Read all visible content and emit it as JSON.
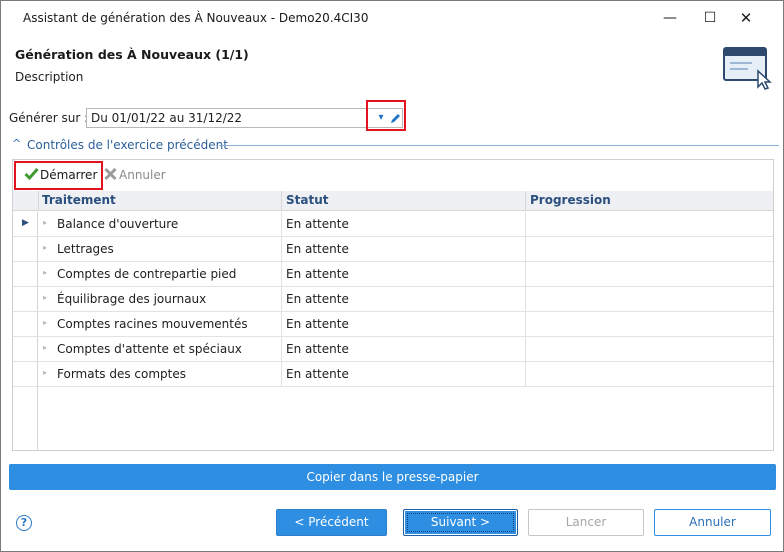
{
  "window": {
    "title": "Assistant de génération des À Nouveaux - Demo20.4CI30",
    "minimize_glyph": "—",
    "maximize_glyph": "☐",
    "close_glyph": "✕"
  },
  "header": {
    "title": "Génération des À Nouveaux (1/1)",
    "description": "Description",
    "icon": "window-cursor-icon"
  },
  "generate": {
    "label": "Générer sur :",
    "value": "Du 01/01/22 au 31/12/22",
    "dropdown_glyph": "▾",
    "icons": [
      "chevron-down-icon",
      "pencil-icon"
    ]
  },
  "group": {
    "title": "Contrôles de l'exercice précédent",
    "chevron_glyph": "^"
  },
  "toolbar": {
    "start_label": "Démarrer",
    "cancel_label": "Annuler"
  },
  "grid": {
    "columns": [
      "Traitement",
      "Statut",
      "Progression"
    ],
    "rows": [
      {
        "traitement": "Balance d'ouverture",
        "statut": "En attente",
        "progression": ""
      },
      {
        "traitement": "Lettrages",
        "statut": "En attente",
        "progression": ""
      },
      {
        "traitement": "Comptes de contrepartie pied",
        "statut": "En attente",
        "progression": ""
      },
      {
        "traitement": "Équilibrage des journaux",
        "statut": "En attente",
        "progression": ""
      },
      {
        "traitement": "Comptes racines mouvementés",
        "statut": "En attente",
        "progression": ""
      },
      {
        "traitement": "Comptes d'attente et spéciaux",
        "statut": "En attente",
        "progression": ""
      },
      {
        "traitement": "Formats des comptes",
        "statut": "En attente",
        "progression": ""
      }
    ],
    "current_row_glyph": "▶",
    "expand_glyph": "▸"
  },
  "copy_button": "Copier dans le presse-papier",
  "help_glyph": "?",
  "footer": {
    "prev": "< Précédent",
    "next": "Suivant >",
    "cancel_disabled": "Lancer",
    "cancel": "Annuler"
  },
  "colors": {
    "accent": "#2e8ee2",
    "highlight_box": "#e2121e",
    "header_text": "#2b4f7e"
  }
}
